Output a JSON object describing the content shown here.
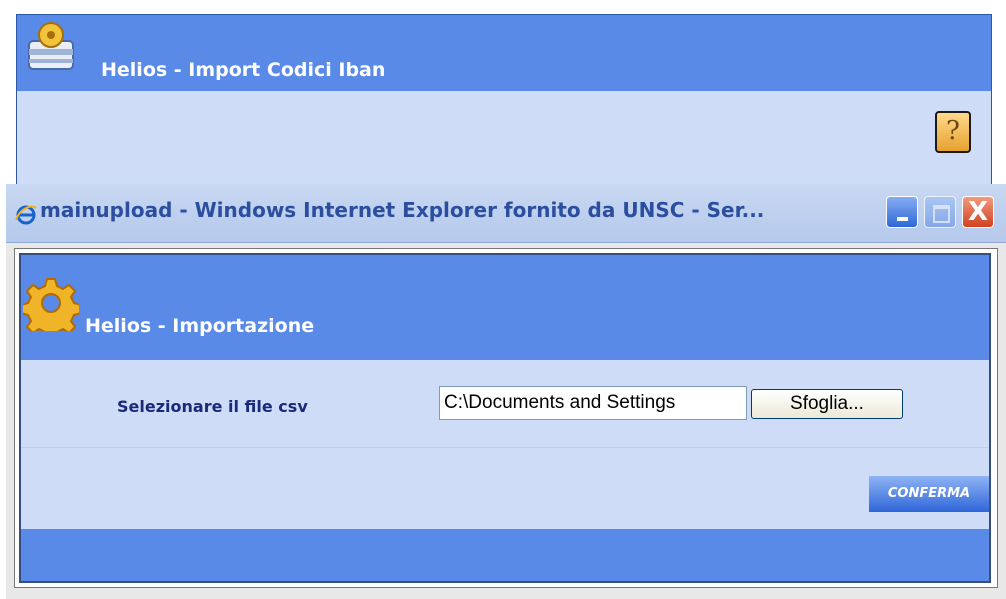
{
  "background_app": {
    "title": "Helios - Import Codici Iban",
    "help_label": "?"
  },
  "ie_window": {
    "title": "mainupload - Windows Internet Explorer fornito da UNSC - Ser...",
    "close_label": "X"
  },
  "app": {
    "title": "Helios - Importazione",
    "file_label": "Selezionare il file csv",
    "file_value": "C:\\Documents and Settings",
    "browse_label": "Sfoglia...",
    "confirm_label": "CONFERMA"
  },
  "colors": {
    "header_blue": "#5a8ae8",
    "panel_light": "#cfdcf8",
    "label_navy": "#1a2a7a",
    "close_red": "#d1421f"
  },
  "icons": {
    "background_logo": "helios-package-icon",
    "help": "help-icon",
    "ie_logo": "ie-logo-icon",
    "app_logo": "gear-icon"
  }
}
